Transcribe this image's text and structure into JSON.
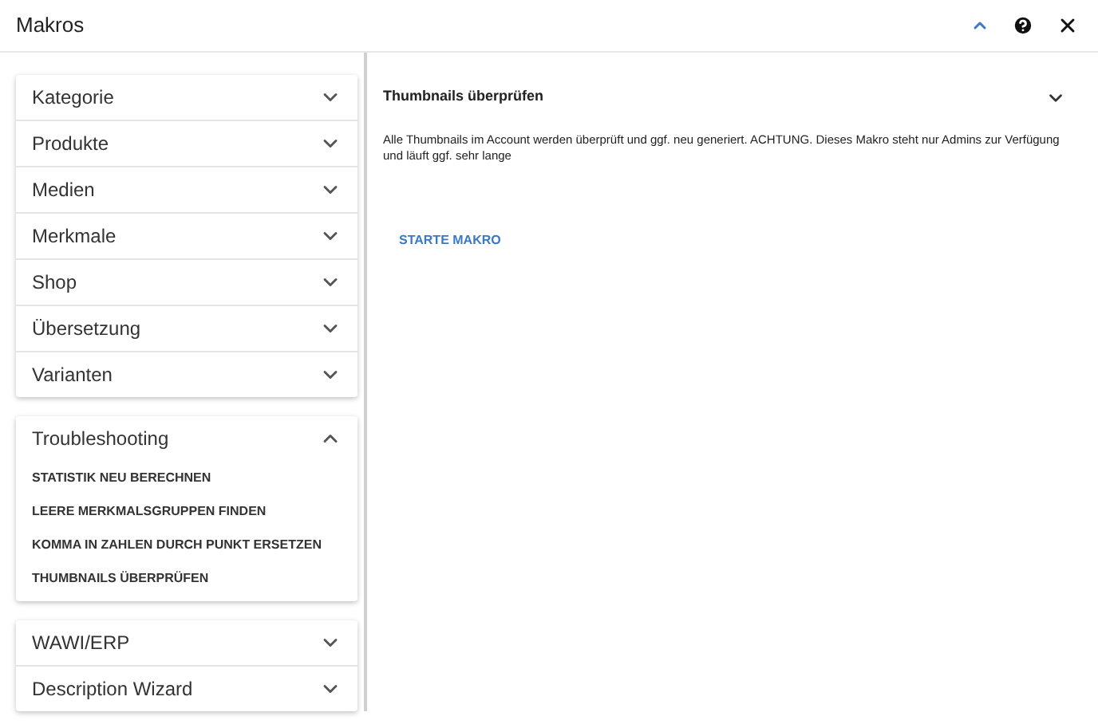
{
  "window": {
    "title": "Makros"
  },
  "sidebar": {
    "groups": [
      {
        "items": [
          {
            "label": "Kategorie",
            "expanded": false
          },
          {
            "label": "Produkte",
            "expanded": false
          },
          {
            "label": "Medien",
            "expanded": false
          },
          {
            "label": "Merkmale",
            "expanded": false
          },
          {
            "label": "Shop",
            "expanded": false
          },
          {
            "label": "Übersetzung",
            "expanded": false
          },
          {
            "label": "Varianten",
            "expanded": false
          }
        ]
      },
      {
        "items": [
          {
            "label": "Troubleshooting",
            "expanded": true,
            "children": [
              "STATISTIK NEU BERECHNEN",
              "LEERE MERKMALSGRUPPEN FINDEN",
              "KOMMA IN ZAHLEN DURCH PUNKT ERSETZEN",
              "THUMBNAILS ÜBERPRÜFEN"
            ]
          }
        ]
      },
      {
        "items": [
          {
            "label": "WAWI/ERP",
            "expanded": false
          },
          {
            "label": "Description Wizard",
            "expanded": false
          }
        ]
      }
    ]
  },
  "detail": {
    "title": "Thumbnails überprüfen",
    "expanded": false,
    "description": "Alle Thumbnails im Account werden überprüft und ggf. neu generiert. ACHTUNG. Dieses Makro steht nur Admins zur Verfügung und läuft ggf. sehr lange",
    "button": "STARTE MAKRO"
  }
}
